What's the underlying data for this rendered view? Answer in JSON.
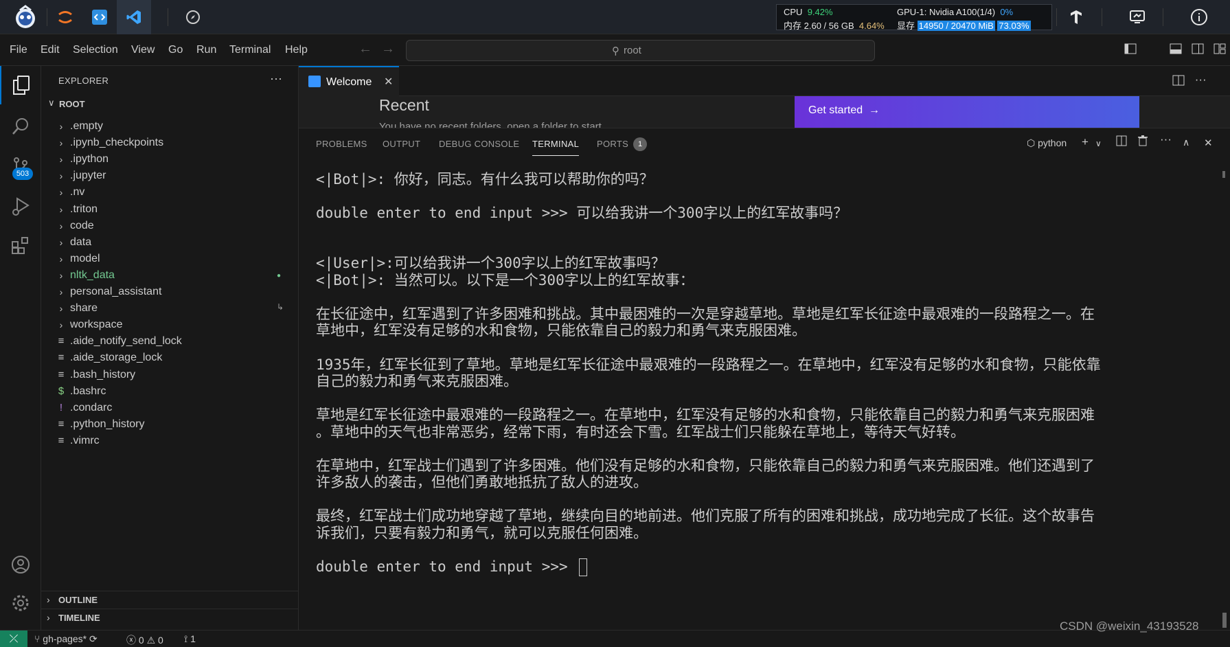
{
  "hostbar": {
    "sysmon": {
      "cpu_label": "CPU",
      "cpu_value": "9.42%",
      "mem_label": "内存",
      "mem_value": "2.60 / 56 GB",
      "mem_percent": "4.64%",
      "gpu_label": "GPU-1: Nvidia A100(1/4)",
      "gpu_value": "0%",
      "vram_label": "显存",
      "vram_value": "14950 / 20470 MiB",
      "vram_percent": "73.03%"
    }
  },
  "menubar": {
    "items": [
      "File",
      "Edit",
      "Selection",
      "View",
      "Go",
      "Run",
      "Terminal",
      "Help"
    ],
    "command_center": "root"
  },
  "activitybar": {
    "scm_badge": "503"
  },
  "sidebar": {
    "title": "EXPLORER",
    "root": "ROOT",
    "items": [
      {
        "name": ".empty",
        "type": "folder"
      },
      {
        "name": ".ipynb_checkpoints",
        "type": "folder"
      },
      {
        "name": ".ipython",
        "type": "folder"
      },
      {
        "name": ".jupyter",
        "type": "folder"
      },
      {
        "name": ".nv",
        "type": "folder"
      },
      {
        "name": ".triton",
        "type": "folder"
      },
      {
        "name": "code",
        "type": "folder"
      },
      {
        "name": "data",
        "type": "folder"
      },
      {
        "name": "model",
        "type": "folder"
      },
      {
        "name": "nltk_data",
        "type": "folder"
      },
      {
        "name": "personal_assistant",
        "type": "folder"
      },
      {
        "name": "share",
        "type": "folder"
      },
      {
        "name": "workspace",
        "type": "folder"
      },
      {
        "name": ".aide_notify_send_lock",
        "type": "file"
      },
      {
        "name": ".aide_storage_lock",
        "type": "file"
      },
      {
        "name": ".bash_history",
        "type": "file"
      },
      {
        "name": ".bashrc",
        "type": "file"
      },
      {
        "name": ".condarc",
        "type": "file"
      },
      {
        "name": ".python_history",
        "type": "file"
      },
      {
        "name": ".vimrc",
        "type": "file"
      }
    ],
    "outline": "OUTLINE",
    "timeline": "TIMELINE"
  },
  "editor": {
    "tab_label": "Welcome",
    "welcome_recent": "Recent",
    "welcome_sub": "You have no recent folders, open a folder to start.",
    "get_started": "Get started"
  },
  "panel": {
    "tabs": [
      "PROBLEMS",
      "OUTPUT",
      "DEBUG CONSOLE",
      "TERMINAL",
      "PORTS"
    ],
    "ports_count": "1",
    "terminal_profile": "python"
  },
  "terminal": {
    "lines": [
      "<|Bot|>: 你好，同志。有什么我可以帮助你的吗？",
      "",
      "double enter to end input >>> 可以给我讲一个300字以上的红军故事吗？",
      "",
      "",
      "<|User|>:可以给我讲一个300字以上的红军故事吗？",
      "<|Bot|>: 当然可以。以下是一个300字以上的红军故事：",
      "",
      "在长征途中，红军遇到了许多困难和挑战。其中最困难的一次是穿越草地。草地是红军长征途中最艰难的一段路程之一。在",
      "草地中，红军没有足够的水和食物，只能依靠自己的毅力和勇气来克服困难。",
      "",
      "1935年，红军长征到了草地。草地是红军长征途中最艰难的一段路程之一。在草地中，红军没有足够的水和食物，只能依靠",
      "自己的毅力和勇气来克服困难。",
      "",
      "草地是红军长征途中最艰难的一段路程之一。在草地中，红军没有足够的水和食物，只能依靠自己的毅力和勇气来克服困难",
      "。草地中的天气也非常恶劣，经常下雨，有时还会下雪。红军战士们只能躲在草地上，等待天气好转。",
      "",
      "在草地中，红军战士们遇到了许多困难。他们没有足够的水和食物，只能依靠自己的毅力和勇气来克服困难。他们还遇到了",
      "许多敌人的袭击，但他们勇敢地抵抗了敌人的进攻。",
      "",
      "最终，红军战士们成功地穿越了草地，继续向目的地前进。他们克服了所有的困难和挑战，成功地完成了长征。这个故事告",
      "诉我们，只要有毅力和勇气，就可以克服任何困难。",
      "",
      "double enter to end input >>> "
    ]
  },
  "statusbar": {
    "branch": "gh-pages*",
    "errors": "0",
    "warnings": "0",
    "ports": "1"
  },
  "watermark": "CSDN @weixin_43193528",
  "colors": {
    "accent": "#0078d4",
    "remote": "#16825d",
    "folder_modified": "#73c991"
  }
}
